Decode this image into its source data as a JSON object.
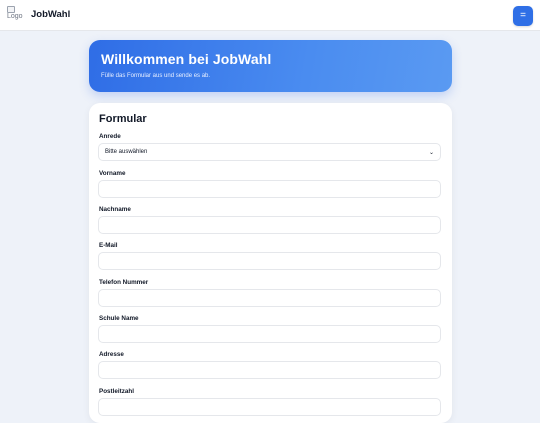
{
  "header": {
    "logo_alt": "Logo",
    "brand": "JobWahl",
    "menu_label": "="
  },
  "hero": {
    "title": "Willkommen bei JobWahl",
    "subtitle": "Fülle das Formular aus und sende es ab."
  },
  "form": {
    "title": "Formular",
    "salutation": {
      "label": "Anrede",
      "selected": "Bitte auswählen"
    },
    "fields": [
      {
        "label": "Vorname",
        "value": ""
      },
      {
        "label": "Nachname",
        "value": ""
      },
      {
        "label": "E-Mail",
        "value": ""
      },
      {
        "label": "Telefon Nummer",
        "value": ""
      },
      {
        "label": "Schule Name",
        "value": ""
      },
      {
        "label": "Adresse",
        "value": ""
      },
      {
        "label": "Postleitzahl",
        "value": ""
      }
    ]
  },
  "colors": {
    "accent": "#2f6fe6",
    "background": "#eef2f9"
  },
  "icons": {
    "menu": "menu-icon",
    "select_chevron": "chevron-down-icon",
    "logo": "broken-image-icon"
  }
}
